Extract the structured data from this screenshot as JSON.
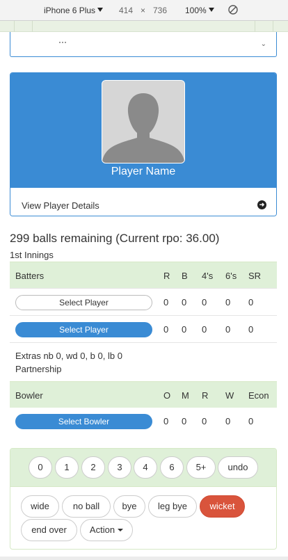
{
  "devtools": {
    "device": "iPhone 6 Plus",
    "width": "414",
    "times": "×",
    "height": "736",
    "zoom": "100%"
  },
  "player": {
    "name": "Player Name",
    "details_link": "View Player Details"
  },
  "status": {
    "balls_remaining": "299 balls remaining (Current rpo: 36.00)",
    "innings": "1st Innings"
  },
  "batters": {
    "headers": {
      "label": "Batters",
      "r": "R",
      "b": "B",
      "fours": "4's",
      "sixes": "6's",
      "sr": "SR"
    },
    "rows": [
      {
        "button": "Select Player",
        "r": "0",
        "b": "0",
        "fours": "0",
        "sixes": "0",
        "sr": "0"
      },
      {
        "button": "Select Player",
        "r": "0",
        "b": "0",
        "fours": "0",
        "sixes": "0",
        "sr": "0"
      }
    ]
  },
  "extras": {
    "text": "Extras nb 0, wd 0, b 0, lb 0",
    "partnership": "Partnership"
  },
  "bowler": {
    "headers": {
      "label": "Bowler",
      "o": "O",
      "m": "M",
      "r": "R",
      "w": "W",
      "econ": "Econ"
    },
    "row": {
      "button": "Select Bowler",
      "o": "0",
      "m": "0",
      "r": "0",
      "w": "0",
      "econ": "0"
    }
  },
  "scoring": {
    "runs": [
      "0",
      "1",
      "2",
      "3",
      "4",
      "6",
      "5+"
    ],
    "undo": "undo",
    "extras": [
      "wide",
      "no ball",
      "bye",
      "leg bye"
    ],
    "wicket": "wicket",
    "end_over": "end over",
    "action": "Action"
  },
  "colors": {
    "primary": "#3a8bd4",
    "success_bg": "#dff0d8",
    "danger": "#d9543c"
  }
}
